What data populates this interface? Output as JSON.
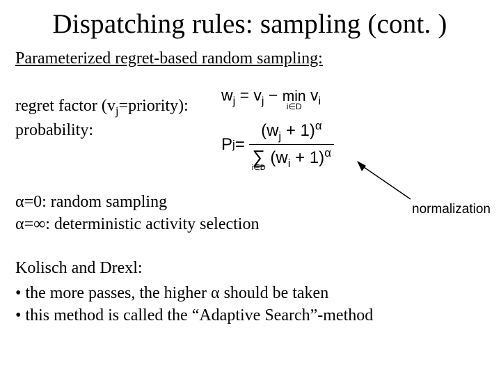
{
  "title": "Dispatching rules: sampling (cont. )",
  "subheading": "Parameterized regret-based random sampling:",
  "lines": {
    "regret_label_pre": "regret factor (v",
    "regret_label_sub": "j",
    "regret_label_post": "=priority):",
    "probability_label": "probability:",
    "alpha0": "α=0: random sampling",
    "alphainf": "α=∞: deterministic activity selection"
  },
  "equations": {
    "regret": {
      "lhs_pre": "w",
      "lhs_sub": "j",
      "eq": " = ",
      "v_pre": "v",
      "v_sub": "j",
      "minus": " − ",
      "min_op": "min",
      "min_under": "i∈D",
      "min_arg_pre": " v",
      "min_arg_sub": "i"
    },
    "prob": {
      "lhs_pre": "P",
      "lhs_sub": "j",
      "eq": " = ",
      "num_open": "(w",
      "num_sub": "j",
      "num_close": " + 1)",
      "num_sup": "α",
      "sum_op": "∑",
      "sum_under": "i∈D",
      "den_open": "(w",
      "den_sub": "i",
      "den_close": " + 1)",
      "den_sup": "α"
    }
  },
  "annotation": "normalization",
  "kolisch": {
    "heading": "Kolisch and Drexl:",
    "b1": "the more passes, the higher α should be taken",
    "b2": "this method is called the “Adaptive Search”-method"
  }
}
